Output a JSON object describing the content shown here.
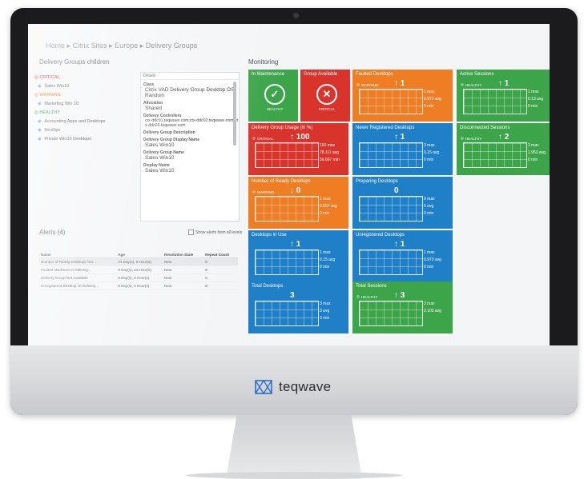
{
  "breadcrumb": {
    "home": "Home",
    "citrix_sites": "Citrix Sites",
    "europe": "Europe",
    "delivery_groups": "Delivery Groups",
    "sep": "▸"
  },
  "left": {
    "title": "Delivery Groups children",
    "tree": [
      {
        "label": "CRITICAL",
        "kind": "crit"
      },
      {
        "label": "Sales Win10",
        "kind": "item"
      },
      {
        "label": "WARNING",
        "kind": "warn"
      },
      {
        "label": "Marketing Win 10",
        "kind": "item"
      },
      {
        "label": "HEALTHY",
        "kind": "healthy"
      },
      {
        "label": "Accounting Apps and Desktops",
        "kind": "item"
      },
      {
        "label": "DevOps",
        "kind": "item"
      },
      {
        "label": "Private Win10 Desktops",
        "kind": "item"
      }
    ],
    "details": {
      "header": "Details",
      "fields": [
        {
          "label": "Class",
          "value": "Citrix VAD Delivery Group Desktop OS Random"
        },
        {
          "label": "Allocation",
          "value": "Shared"
        },
        {
          "label": "Delivery Controllers",
          "value": "ctx-ddc01.teqwave.com;ctx-ddc02.teqwave.com;ctx-ddc03.teqwave.com"
        },
        {
          "label": "Delivery Group Description",
          "value": ""
        },
        {
          "label": "Delivery Group Display Name",
          "value": "Sales Win10"
        },
        {
          "label": "Delivery Group Name",
          "value": "Sales Win10"
        },
        {
          "label": "Display Name",
          "value": "Sales Win10"
        }
      ]
    }
  },
  "alerts": {
    "title": "Alerts (4)",
    "toggle_label": "Show alerts from all levels",
    "columns": [
      "Name",
      "Age",
      "Resolution State",
      "Repeat Count"
    ],
    "rows": [
      [
        "Number of Ready Desktops Too...",
        "23 Day(s), 8 Hour(s)",
        "New",
        "0"
      ],
      [
        "Faulted Machines in Delivery...",
        "8 Day(s), 23 Hour(s)",
        "New",
        "0"
      ],
      [
        "Delivery Group Not Available",
        "8 Day(s), 3 Hour(s)",
        "New",
        "0"
      ],
      [
        "Unregistered Desktop Of Delivery...",
        "8 Day(s), 3 Hour(s)",
        "New",
        "0"
      ]
    ]
  },
  "monitoring": {
    "title": "Monitoring",
    "tiles": [
      {
        "title": "In Maintenance",
        "color": "#3ca54a",
        "status": "HEALTHY",
        "kind": "status",
        "icon": "✓"
      },
      {
        "title": "Group Available",
        "color": "#d9342b",
        "status": "CRITICAL",
        "kind": "status",
        "icon": "✕"
      },
      {
        "title": "Faulted Desktops",
        "color": "#ee7d24",
        "state": "WARNING",
        "arrow": "↑",
        "count": "1",
        "stats": [
          "1 max",
          "0.973 avg",
          "0 min"
        ]
      },
      {
        "title": "Active Sessions",
        "color": "#3ca54a",
        "state": "HEALTHY",
        "arrow": "↑",
        "count": "1",
        "stats": [
          "1 max",
          "0.13 avg",
          "0 min"
        ]
      },
      {
        "title": "Delivery Group Usage (in %)",
        "color": "#d9342b",
        "state": "CRITICAL",
        "arrow": "↑",
        "count": "100",
        "stats": [
          "100 max",
          "78.111 avg",
          "56.667 min"
        ]
      },
      {
        "title": "Never Registered Desktops",
        "color": "#1f7fc7",
        "state": "",
        "arrow": "↑",
        "count": "1",
        "stats": [
          "3 max",
          "0.15 avg",
          "0 min"
        ]
      },
      {
        "title": "Disconnected Sessions",
        "color": "#3ca54a",
        "state": "HEALTHY",
        "arrow": "↑",
        "count": "2",
        "stats": [
          "2 max",
          "1.953 avg",
          "0 min"
        ]
      },
      {
        "title": "Number of Ready Desktops",
        "color": "#ee7d24",
        "state": "WARNING",
        "arrow": "↓",
        "count": "0",
        "stats": [
          "1 max",
          "0.897 avg",
          "0 min"
        ]
      },
      {
        "title": "Preparing Desktops",
        "color": "#1f7fc7",
        "state": "",
        "arrow": "",
        "count": "0",
        "stats": [
          "0 max",
          "0 avg",
          "0 min"
        ]
      },
      {
        "title": "Desktops in Use",
        "color": "#1f7fc7",
        "state": "",
        "arrow": "↑",
        "count": "1",
        "stats": [
          "1 max",
          "0.15 avg",
          "0 min"
        ]
      },
      {
        "title": "Unregistered Desktops",
        "color": "#1f7fc7",
        "state": "",
        "arrow": "↑",
        "count": "1",
        "stats": [
          "1 max",
          "0.973 avg",
          "0 min"
        ]
      },
      {
        "title": "Total Desktops",
        "color": "#1f7fc7",
        "state": "",
        "arrow": "",
        "count": "3",
        "stats": [
          "3 max",
          "3 avg",
          "3 min"
        ]
      },
      {
        "title": "Total Sessions",
        "color": "#3ca54a",
        "state": "HEALTHY",
        "arrow": "↑",
        "count": "3",
        "stats": [
          "3 max",
          "2.103 avg",
          ""
        ]
      }
    ]
  },
  "brand": {
    "name": "teqwave"
  }
}
